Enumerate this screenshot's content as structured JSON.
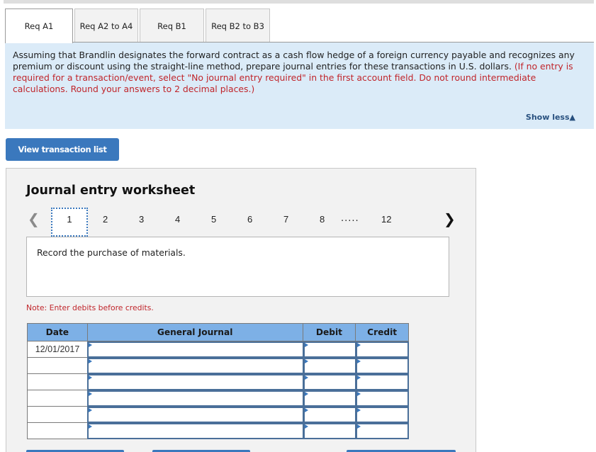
{
  "tabs": [
    {
      "label": "Req A1",
      "active": true
    },
    {
      "label": "Req A2 to A4",
      "active": false
    },
    {
      "label": "Req B1",
      "active": false
    },
    {
      "label": "Req B2 to B3",
      "active": false
    }
  ],
  "instructions": {
    "main": "Assuming that Brandlin designates the forward contract as a cash flow hedge of a foreign currency payable and recognizes any premium or discount using the straight-line method, prepare journal entries for these transactions in U.S. dollars.",
    "note": "(If no entry is required for a transaction/event, select \"No journal entry required\" in the first account field. Do not round intermediate calculations. Round your answers to 2 decimal places.)",
    "show_less": "Show less",
    "show_less_icon": "triangle-up-icon"
  },
  "view_transaction_list": "View transaction list",
  "worksheet": {
    "title": "Journal entry worksheet",
    "pager": {
      "prev_icon": "chevron-left-icon",
      "next_icon": "chevron-right-icon",
      "pages": [
        "1",
        "2",
        "3",
        "4",
        "5",
        "6",
        "7",
        "8"
      ],
      "ellipsis": ".....",
      "last": "12",
      "current": "1"
    },
    "description": "Record the purchase of materials.",
    "note": "Note: Enter debits before credits.",
    "table": {
      "headers": {
        "date": "Date",
        "journal": "General Journal",
        "debit": "Debit",
        "credit": "Credit"
      },
      "rows": [
        {
          "date": "12/01/2017",
          "account": "",
          "debit": "",
          "credit": ""
        },
        {
          "date": "",
          "account": "",
          "debit": "",
          "credit": ""
        },
        {
          "date": "",
          "account": "",
          "debit": "",
          "credit": ""
        },
        {
          "date": "",
          "account": "",
          "debit": "",
          "credit": ""
        },
        {
          "date": "",
          "account": "",
          "debit": "",
          "credit": ""
        },
        {
          "date": "",
          "account": "",
          "debit": "",
          "credit": ""
        }
      ]
    }
  }
}
